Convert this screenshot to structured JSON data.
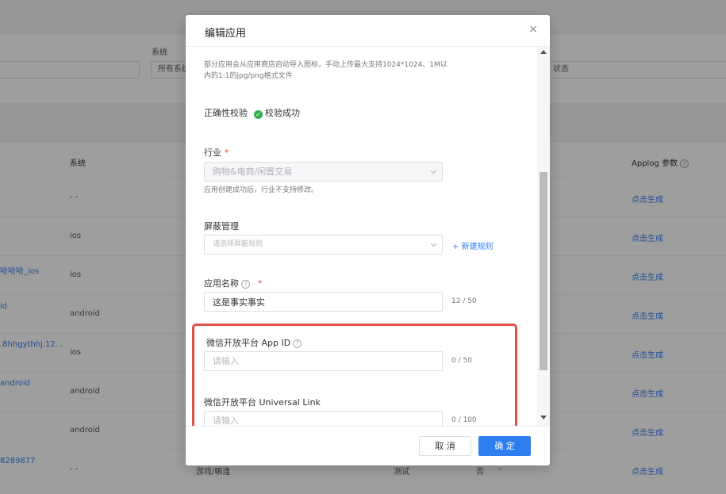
{
  "background": {
    "filters": {
      "system_label": "系统",
      "system_value": "所有系统",
      "status_value": "状态"
    },
    "table": {
      "col_system": "系统",
      "col_applog": "Applog 参数",
      "rows": [
        {
          "name": "",
          "system": "- -",
          "link": "点击生成"
        },
        {
          "name": "",
          "system": "ios",
          "link": "点击生成"
        },
        {
          "name": "哈哈哈_ios",
          "system": "ios",
          "link": "点击生成"
        },
        {
          "name": "id",
          "system": "android",
          "link": "点击生成"
        },
        {
          "name": ".8hhgythhj.12...",
          "system": "ios",
          "link": "点击生成"
        },
        {
          "name": "android",
          "system": "android",
          "link": "点击生成"
        },
        {
          "name": "",
          "system": "android",
          "link": "点击生成"
        },
        {
          "name": "8289877",
          "system": "- -",
          "extra": "游戏/嘛逢",
          "extra2": "测试",
          "extra3": "否",
          "extra4": "-",
          "link": "点击生成"
        }
      ]
    }
  },
  "modal": {
    "title": "编辑应用",
    "close_icon": "×",
    "icon_hint_line1": "部分应用会从应用商店自动导入图标，手动上传最大支持1024*1024、1M以",
    "icon_hint_line2": "内的1:1的jpg/png格式文件",
    "validation_label": "正确性校验",
    "validation_icon": "✓",
    "validation_status": "校验成功",
    "industry_label": "行业",
    "industry_required": "*",
    "industry_value": "购物&电商/闲置交易",
    "industry_hint": "应用创建成功后，行业不支持修改。",
    "block_label": "屏蔽管理",
    "block_placeholder": "请选择屏蔽规则",
    "block_add": "+ 新建规则",
    "appname_label": "应用名称",
    "appname_help_icon": "?",
    "appname_required": "*",
    "appname_value": "这是事实事实",
    "appname_counter": "12 / 50",
    "wx_appid_label": "微信开放平台 App ID",
    "wx_appid_help_icon": "?",
    "wx_appid_placeholder": "请输入",
    "wx_appid_counter": "0 / 50",
    "wx_link_label": "微信开放平台 Universal Link",
    "wx_link_placeholder": "请输入",
    "wx_link_counter": "0 / 100",
    "cancel_label": "取 消",
    "ok_label": "确 定"
  },
  "colors": {
    "primary": "#2f7ef0",
    "success": "#2fb14e",
    "highlight": "#e2504b",
    "required": "#e54d42"
  }
}
